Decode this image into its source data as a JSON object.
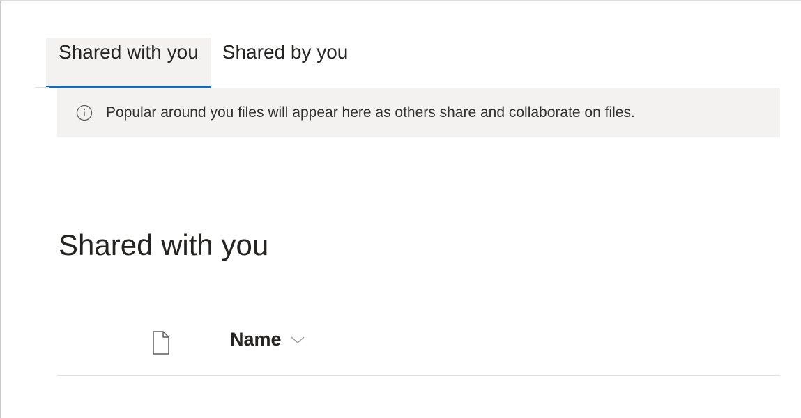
{
  "tabs": [
    {
      "label": "Shared with you",
      "active": true
    },
    {
      "label": "Shared by you",
      "active": false
    }
  ],
  "banner": {
    "icon": "info-icon",
    "text": "Popular around you files will appear here as others share and collaborate on files."
  },
  "section": {
    "title": "Shared with you"
  },
  "list": {
    "file_type_icon": "document-icon",
    "columns": [
      {
        "label": "Name",
        "sort_icon": "chevron-down-icon"
      }
    ]
  },
  "colors": {
    "accent": "#0f6cbd",
    "banner_bg": "#f3f2f1",
    "text": "#252423"
  }
}
